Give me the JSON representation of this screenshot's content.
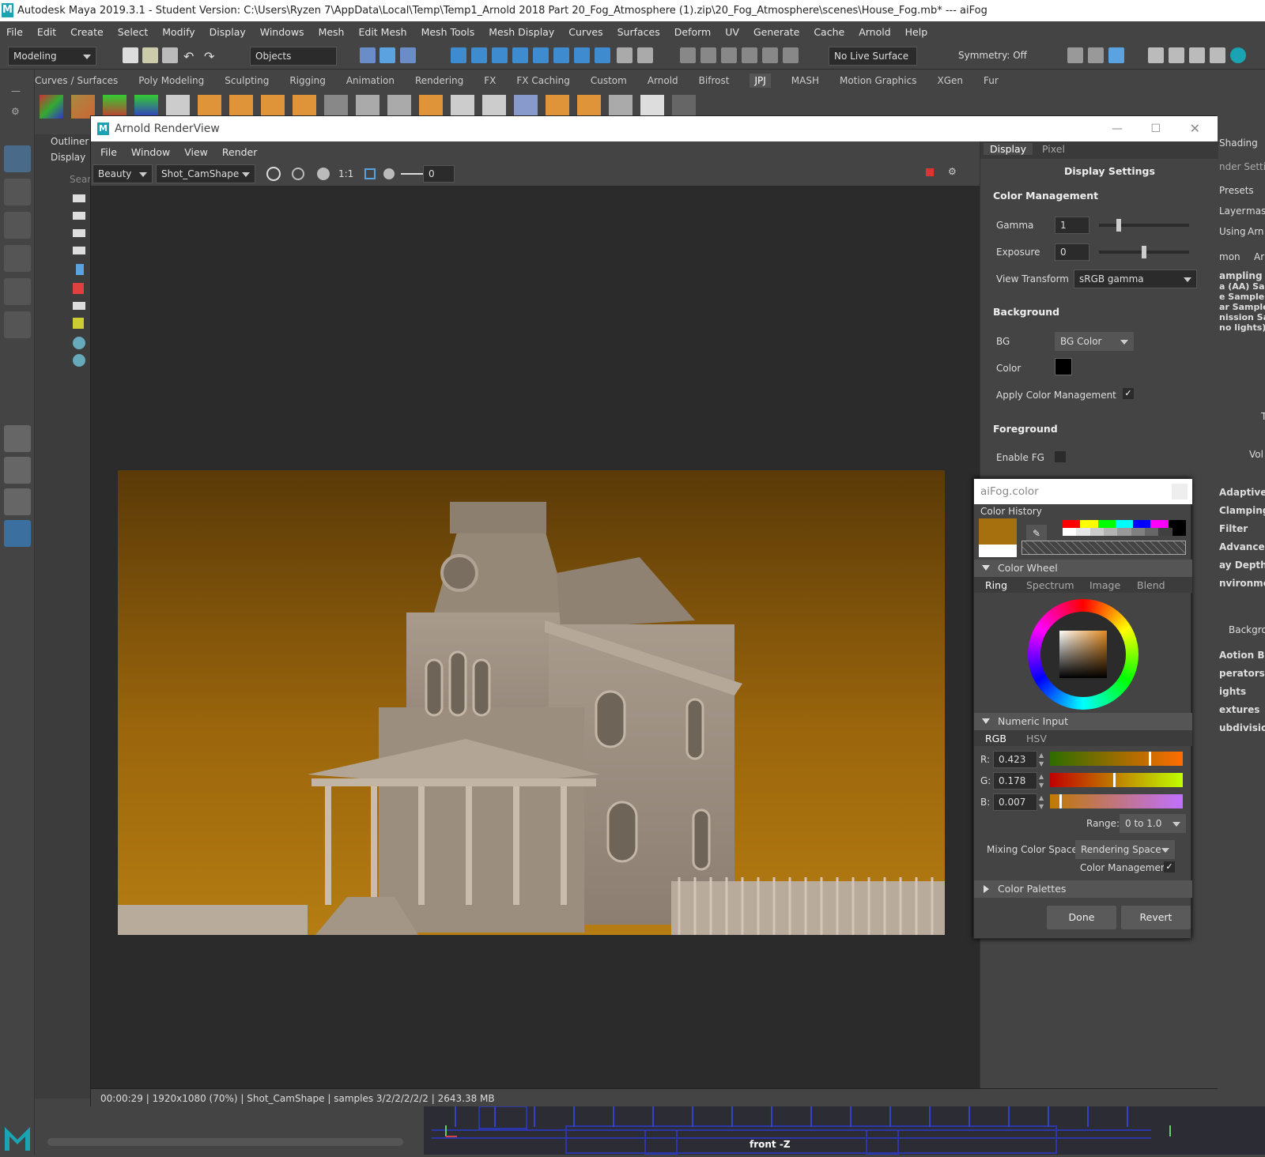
{
  "window": {
    "title": "Autodesk Maya 2019.3.1 - Student Version: C:\\Users\\Ryzen 7\\AppData\\Local\\Temp\\Temp1_Arnold 2018 Part 20_Fog_Atmosphere (1).zip\\20_Fog_Atmosphere\\scenes\\House_Fog.mb*   ---   aiFog"
  },
  "menubar": [
    "File",
    "Edit",
    "Create",
    "Select",
    "Modify",
    "Display",
    "Windows",
    "Mesh",
    "Edit Mesh",
    "Mesh Tools",
    "Mesh Display",
    "Curves",
    "Surfaces",
    "Deform",
    "UV",
    "Generate",
    "Cache",
    "Arnold",
    "Help"
  ],
  "statusline": {
    "mode": "Modeling",
    "objects": "Objects",
    "live_surface": "No Live Surface",
    "symmetry": "Symmetry: Off"
  },
  "shelf_tabs": [
    "Curves / Surfaces",
    "Poly Modeling",
    "Sculpting",
    "Rigging",
    "Animation",
    "Rendering",
    "FX",
    "FX Caching",
    "Custom",
    "Arnold",
    "Bifrost",
    "JPJ",
    "MASH",
    "Motion Graphics",
    "XGen",
    "Fur"
  ],
  "shelf_active": "JPJ",
  "outliner": {
    "title": "Outliner",
    "display": "Display",
    "search": "Sear"
  },
  "renderview": {
    "title": "Arnold RenderView",
    "menu": [
      "File",
      "Window",
      "View",
      "Render"
    ],
    "aov": "Beauty",
    "camera": "Shot_CamShape",
    "ratio": "1:1",
    "frame": "0",
    "status": "00:00:29 | 1920x1080 (70%) | Shot_CamShape  | samples 3/2/2/2/2/2 | 2643.38 MB"
  },
  "display_panel": {
    "tabs": [
      "Display",
      "Pixel"
    ],
    "heading": "Display Settings",
    "color_management": {
      "label": "Color Management",
      "gamma_label": "Gamma",
      "gamma": "1",
      "exposure_label": "Exposure",
      "exposure": "0",
      "view_transform_label": "View Transform",
      "view_transform": "sRGB gamma"
    },
    "background": {
      "label": "Background",
      "bg_label": "BG",
      "bg": "BG Color",
      "color_label": "Color",
      "apply_label": "Apply Color Management"
    },
    "foreground": {
      "label": "Foreground",
      "enable_label": "Enable FG"
    }
  },
  "attribute_editor": {
    "tab": "Shading",
    "header": "nder Settin",
    "presets": "Presets",
    "layer": "Layer",
    "layer_value": "mas",
    "using": "Using",
    "using_value": "Arn",
    "mon": "mon",
    "ar": "Ar",
    "lines": [
      "ampling",
      "a (AA) Sam",
      "e Samples :",
      "ar Samples",
      "nission Sam",
      "no lights) :"
    ],
    "t": "T",
    "vol": "Vol",
    "sections": [
      "Adaptive S",
      "Clamping",
      "Filter",
      "Advanced",
      "ay Depth",
      "nvironmer"
    ],
    "backgrou": "Backgrou",
    "sections2": [
      "Aotion Blu",
      "perators",
      "ights",
      "extures",
      "ubdivision"
    ]
  },
  "color_picker": {
    "title": "aiFog.color",
    "history_label": "Color History",
    "current_color": "#a6700f",
    "prev_color": "#ffffff",
    "history_row1": [
      "#ff0000",
      "#ffff00",
      "#00ff00",
      "#00ffff",
      "#0000ff",
      "#ff00ff",
      "#000000"
    ],
    "history_row2": [
      "#ffffff",
      "#e6e6e6",
      "#cccccc",
      "#b3b3b3",
      "#999999",
      "#808080",
      "#666666",
      "#404040",
      "#000000"
    ],
    "wheel_label": "Color Wheel",
    "wheel_tabs": [
      "Ring",
      "Spectrum",
      "Image",
      "Blend"
    ],
    "numeric_label": "Numeric Input",
    "numeric_tabs": [
      "RGB",
      "HSV"
    ],
    "r_label": "R:",
    "r": "0.423",
    "g_label": "G:",
    "g": "0.178",
    "b_label": "B:",
    "b": "0.007",
    "range_label": "Range:",
    "range": "0 to 1.0",
    "mixing_label": "Mixing Color Space:",
    "mixing": "Rendering Space",
    "cm_label": "Color Management",
    "palettes_label": "Color Palettes",
    "done": "Done",
    "revert": "Revert"
  },
  "timeline": {
    "view_label": "front -Z"
  }
}
